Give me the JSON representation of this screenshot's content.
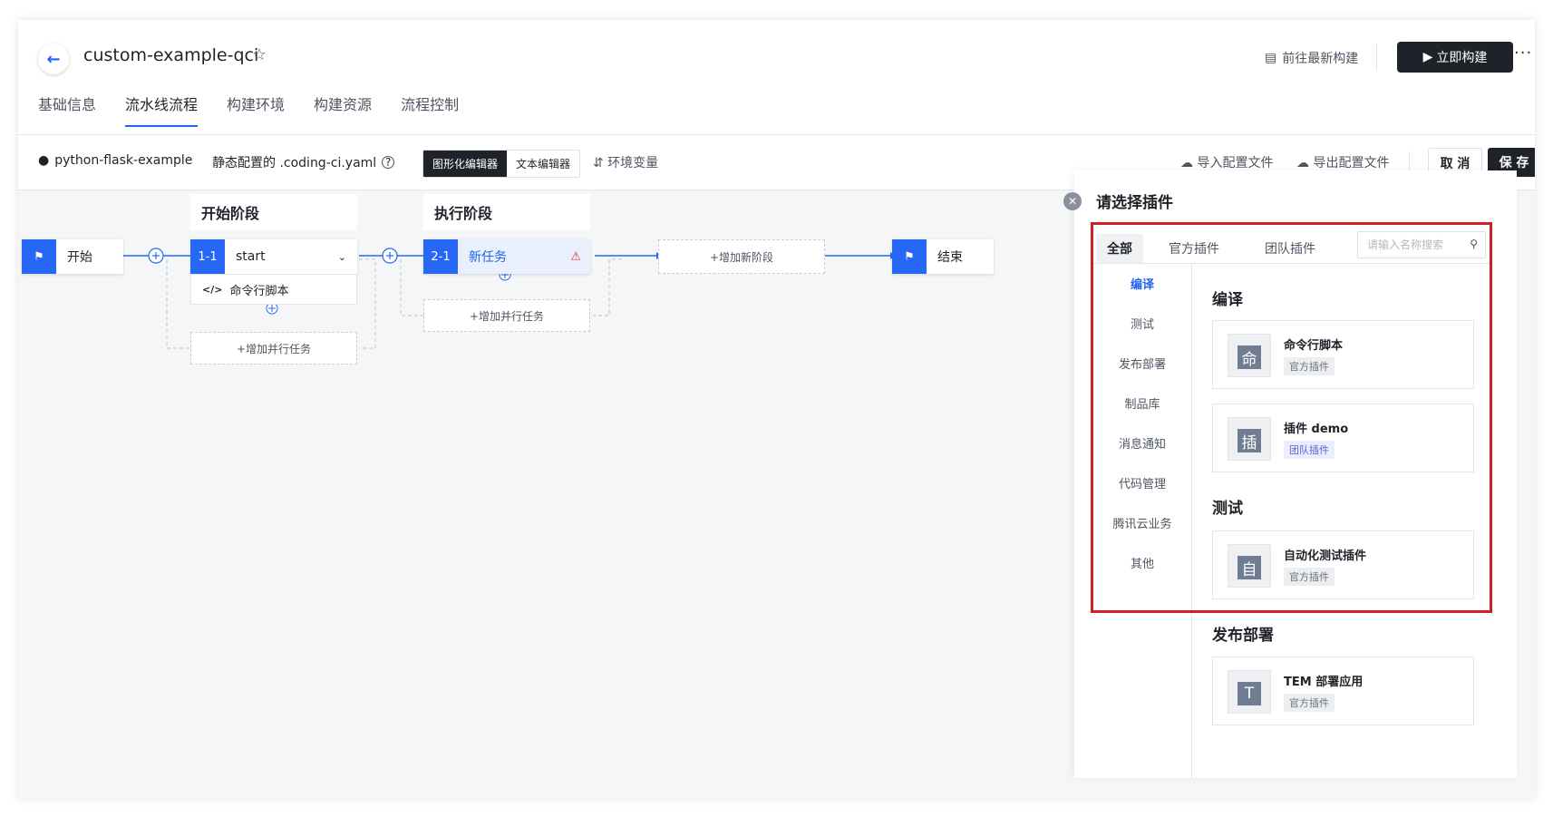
{
  "header": {
    "back_icon": "arrow-left-icon",
    "project_name": "custom-example-qci",
    "latest_build_label": "前往最新构建",
    "run_build_label": "立即构建",
    "more_label": "···"
  },
  "tabs": [
    {
      "label": "基础信息"
    },
    {
      "label": "流水线流程",
      "active": true
    },
    {
      "label": "构建环境"
    },
    {
      "label": "构建资源"
    },
    {
      "label": "流程控制"
    }
  ],
  "toolbar": {
    "repo_name": "python-flask-example",
    "config_text": "静态配置的 .coding-ci.yaml",
    "graphic_editor_label": "图形化编辑器",
    "text_editor_label": "文本编辑器",
    "env_var_label": "环境变量",
    "import_label": "导入配置文件",
    "export_label": "导出配置文件",
    "cancel_label": "取 消",
    "save_label": "保 存"
  },
  "pipeline": {
    "start_label": "开始",
    "end_label": "结束",
    "stage1": {
      "title": "开始阶段",
      "job_badge": "1-1",
      "job_name": "start",
      "task": "命令行脚本",
      "add_parallel": "+增加并行任务"
    },
    "stage2": {
      "title": "执行阶段",
      "job_badge": "2-1",
      "job_name": "新任务",
      "add_parallel": "+增加并行任务"
    },
    "add_stage": "+增加新阶段"
  },
  "plugin_panel": {
    "title": "请选择插件",
    "tabs": [
      {
        "label": "全部",
        "active": true
      },
      {
        "label": "官方插件"
      },
      {
        "label": "团队插件"
      }
    ],
    "search_placeholder": "请输入名称搜索",
    "categories": [
      {
        "label": "编译",
        "active": true
      },
      {
        "label": "测试"
      },
      {
        "label": "发布部署"
      },
      {
        "label": "制品库"
      },
      {
        "label": "消息通知"
      },
      {
        "label": "代码管理"
      },
      {
        "label": "腾讯云业务"
      },
      {
        "label": "其他"
      }
    ],
    "sections": {
      "compile": {
        "title": "编译",
        "plugins": [
          {
            "glyph": "命",
            "name": "命令行脚本",
            "tag": "官方插件"
          },
          {
            "glyph": "插",
            "name": "插件 demo",
            "tag": "团队插件"
          }
        ]
      },
      "test": {
        "title": "测试",
        "plugins": [
          {
            "glyph": "自",
            "name": "自动化测试插件",
            "tag": "官方插件"
          }
        ]
      },
      "deploy": {
        "title": "发布部署",
        "plugins": [
          {
            "glyph": "T",
            "name": "TEM 部署应用",
            "tag": "官方插件"
          }
        ]
      }
    }
  },
  "colors": {
    "accent": "#2667f5",
    "dark_button": "#1f2329",
    "highlight_border": "#d41e25"
  }
}
